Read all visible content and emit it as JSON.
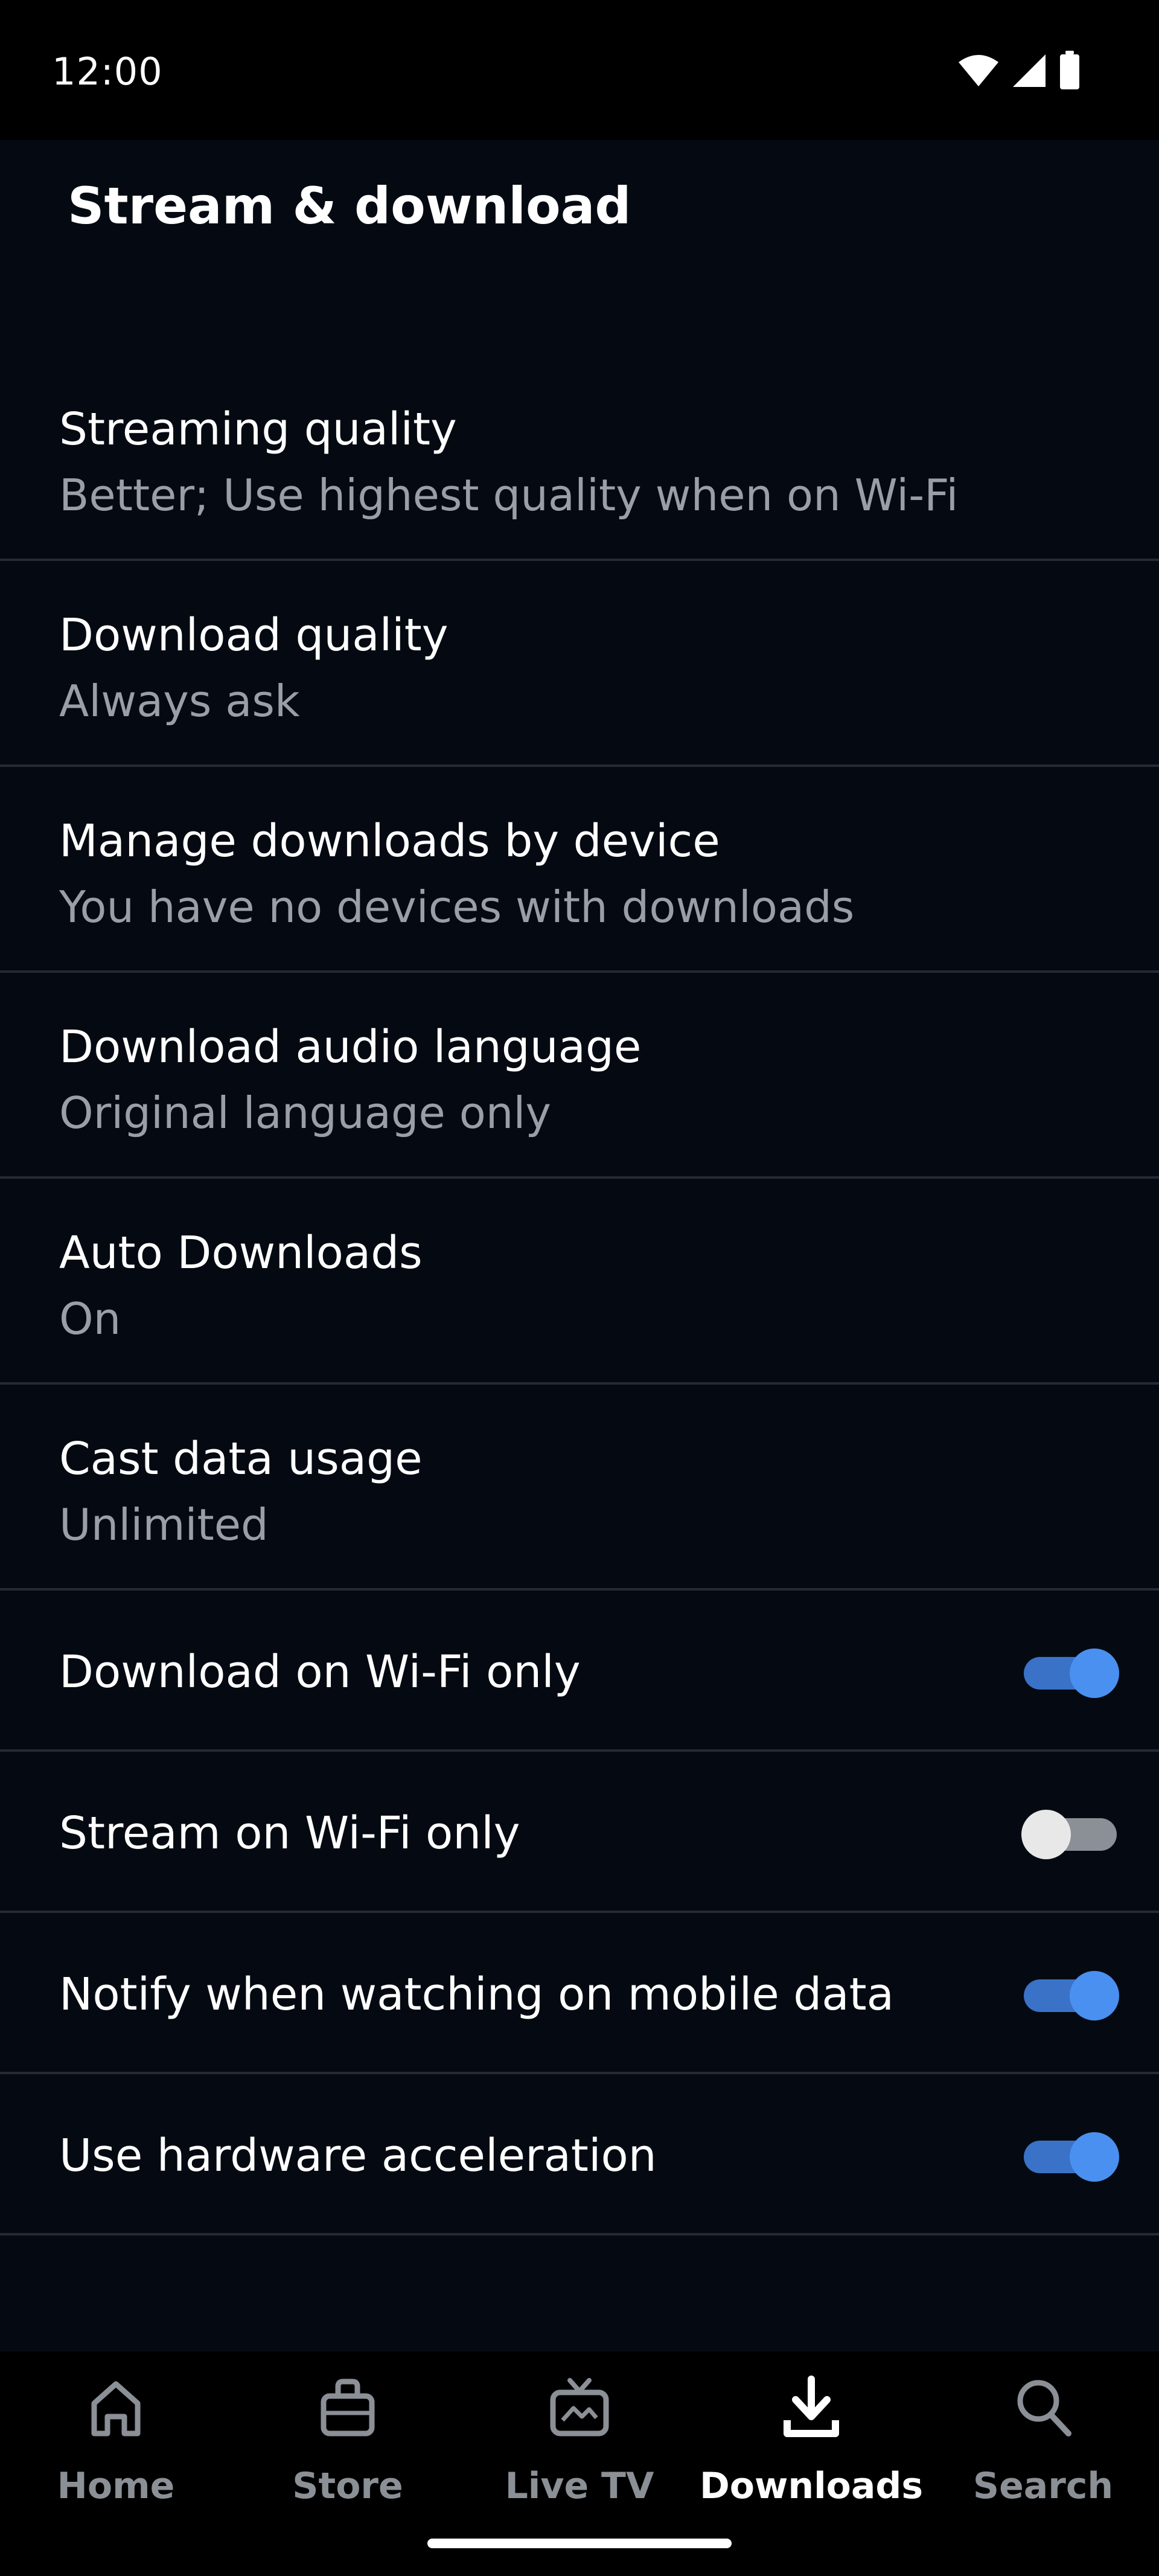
{
  "status_bar": {
    "time": "12:00",
    "icons": [
      "wifi-icon",
      "signal-icon",
      "battery-icon"
    ]
  },
  "page": {
    "title": "Stream & download"
  },
  "settings": [
    {
      "title": "Streaming quality",
      "subtitle": "Better; Use highest quality when on Wi-Fi"
    },
    {
      "title": "Download quality",
      "subtitle": "Always ask"
    },
    {
      "title": "Manage downloads by device",
      "subtitle": "You have no devices with downloads"
    },
    {
      "title": "Download audio language",
      "subtitle": "Original language only"
    },
    {
      "title": "Auto Downloads",
      "subtitle": "On"
    },
    {
      "title": "Cast data usage",
      "subtitle": "Unlimited"
    }
  ],
  "toggles": [
    {
      "title": "Download on Wi-Fi only",
      "on": true
    },
    {
      "title": "Stream on Wi-Fi only",
      "on": false
    },
    {
      "title": "Notify when watching on mobile data",
      "on": true
    },
    {
      "title": "Use hardware acceleration",
      "on": true
    }
  ],
  "bottom_nav": {
    "items": [
      {
        "label": "Home",
        "icon": "home-icon",
        "active": false
      },
      {
        "label": "Store",
        "icon": "store-icon",
        "active": false
      },
      {
        "label": "Live TV",
        "icon": "live-tv-icon",
        "active": false
      },
      {
        "label": "Downloads",
        "icon": "download-icon",
        "active": true
      },
      {
        "label": "Search",
        "icon": "search-icon",
        "active": false
      }
    ]
  },
  "colors": {
    "background": "#050a12",
    "toggle_on": "#4a90f0",
    "subtitle": "#9a9ea6",
    "inactive_nav": "#8b8f96"
  }
}
